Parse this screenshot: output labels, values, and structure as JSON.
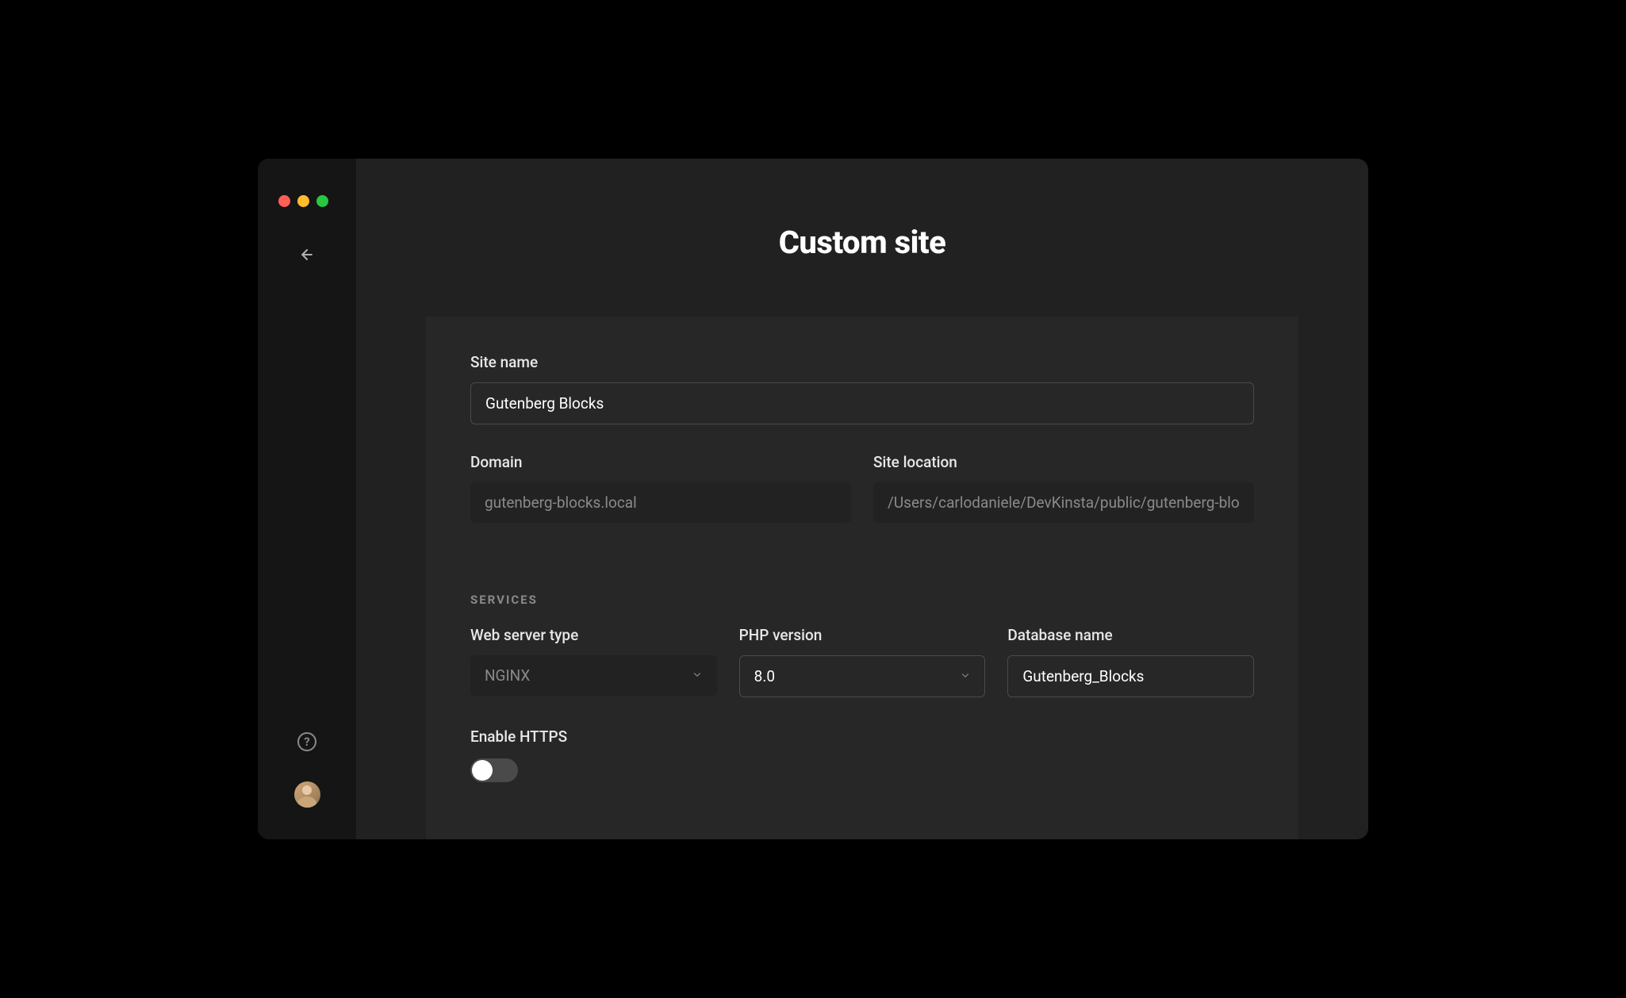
{
  "page": {
    "title": "Custom site"
  },
  "form": {
    "site_name": {
      "label": "Site name",
      "value": "Gutenberg Blocks"
    },
    "domain": {
      "label": "Domain",
      "value": "gutenberg-blocks.local"
    },
    "site_location": {
      "label": "Site location",
      "value": "/Users/carlodaniele/DevKinsta/public/gutenberg-bloc"
    },
    "services": {
      "header": "SERVICES",
      "web_server": {
        "label": "Web server type",
        "value": "NGINX"
      },
      "php_version": {
        "label": "PHP version",
        "value": "8.0"
      },
      "database_name": {
        "label": "Database name",
        "value": "Gutenberg_Blocks"
      },
      "https": {
        "label": "Enable HTTPS",
        "enabled": false
      }
    }
  }
}
